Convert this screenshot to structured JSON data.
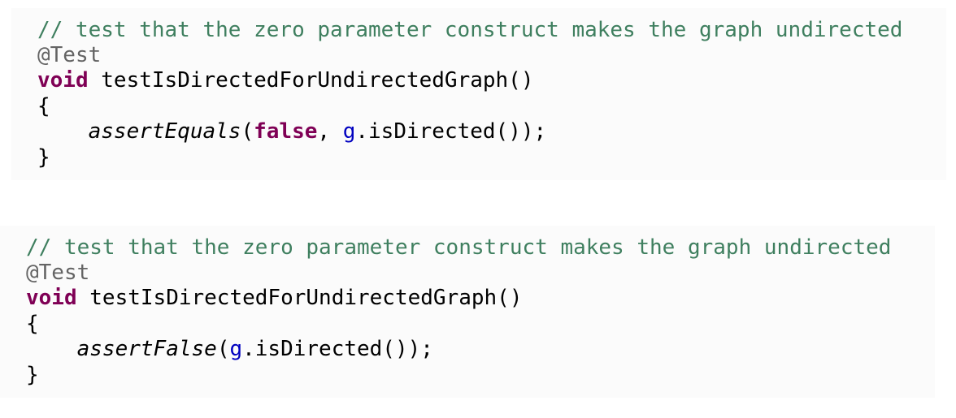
{
  "snippets": [
    {
      "comment": "// test that the zero parameter construct makes the graph undirected",
      "annotation": "@Test",
      "return_type": "void",
      "method_signature": " testIsDirectedForUndirectedGraph()",
      "open_brace": "{",
      "body": {
        "indent": "    ",
        "call": "assertEquals",
        "open_paren": "(",
        "literal": "false",
        "separator": ", ",
        "object": "g",
        "rest": ".isDirected());"
      },
      "close_brace": "}"
    },
    {
      "comment": "// test that the zero parameter construct makes the graph undirected",
      "annotation": "@Test",
      "return_type": "void",
      "method_signature": " testIsDirectedForUndirectedGraph()",
      "open_brace": "{",
      "body": {
        "indent": "    ",
        "call": "assertFalse",
        "open_paren": "(",
        "object": "g",
        "rest": ".isDirected());"
      },
      "close_brace": "}"
    }
  ]
}
